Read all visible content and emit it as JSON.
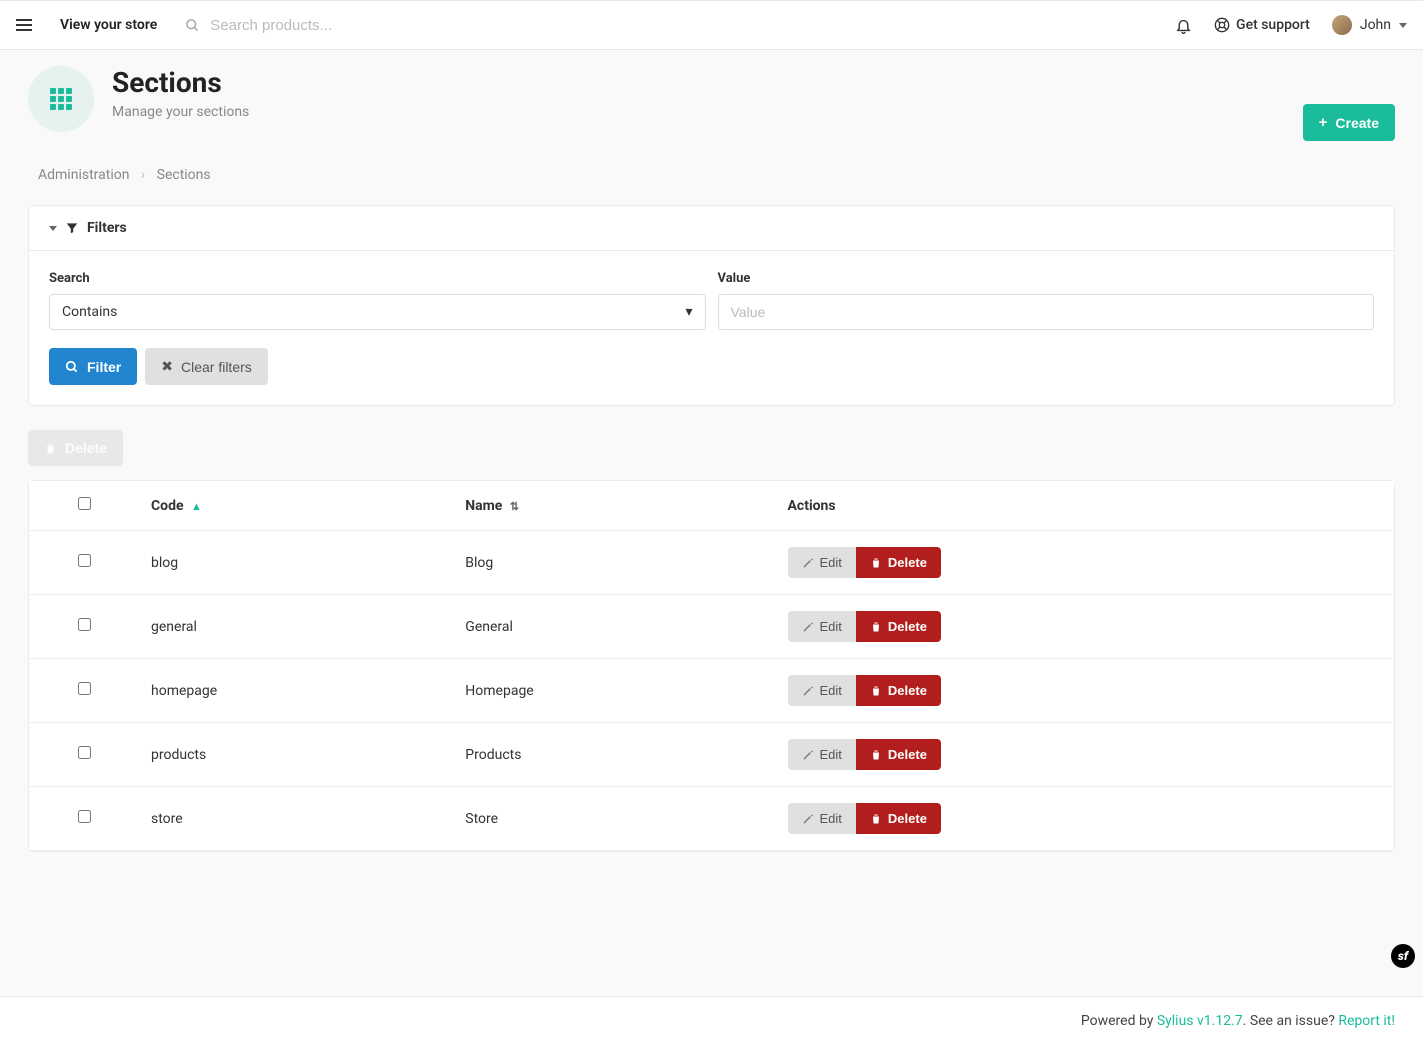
{
  "topbar": {
    "view_store": "View your store",
    "search_placeholder": "Search products...",
    "get_support": "Get support",
    "user_name": "John"
  },
  "page": {
    "title": "Sections",
    "subtitle": "Manage your sections",
    "create_label": "Create"
  },
  "breadcrumb": {
    "root": "Administration",
    "current": "Sections"
  },
  "filters": {
    "header": "Filters",
    "search_label": "Search",
    "search_type": "Contains",
    "value_label": "Value",
    "value_placeholder": "Value",
    "filter_btn": "Filter",
    "clear_btn": "Clear filters"
  },
  "bulk": {
    "delete_label": "Delete"
  },
  "table": {
    "col_code": "Code",
    "col_name": "Name",
    "col_actions": "Actions",
    "edit_label": "Edit",
    "delete_label": "Delete",
    "rows": [
      {
        "code": "blog",
        "name": "Blog"
      },
      {
        "code": "general",
        "name": "General"
      },
      {
        "code": "homepage",
        "name": "Homepage"
      },
      {
        "code": "products",
        "name": "Products"
      },
      {
        "code": "store",
        "name": "Store"
      }
    ]
  },
  "footer": {
    "powered_by": "Powered by ",
    "sylius": "Sylius v1.12.7",
    "see_issue": ". See an issue? ",
    "report": "Report it!"
  }
}
